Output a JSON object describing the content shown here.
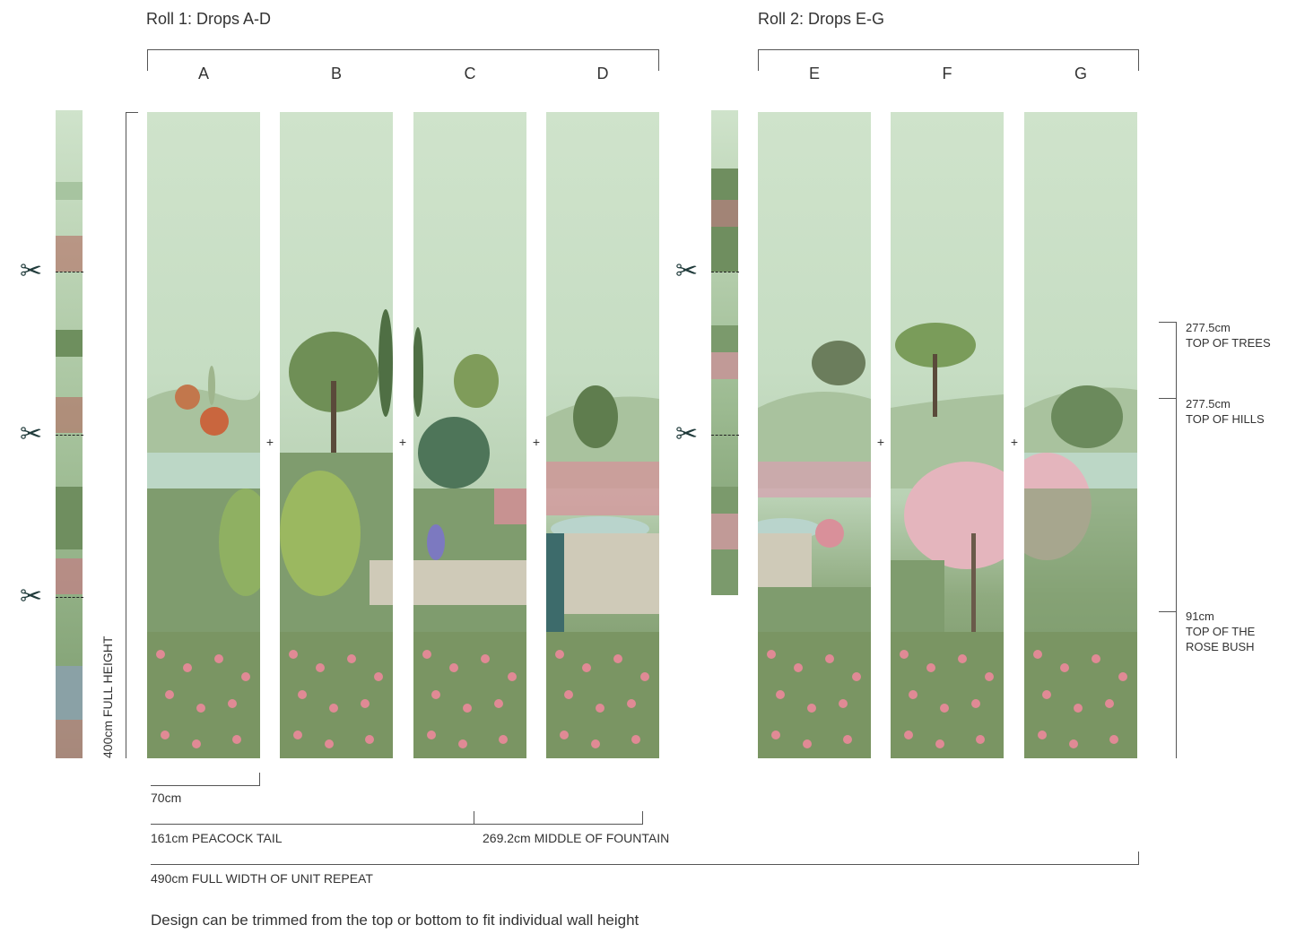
{
  "rolls": [
    {
      "title": "Roll 1: Drops A-D",
      "drops": [
        "A",
        "B",
        "C",
        "D"
      ]
    },
    {
      "title": "Roll 2: Drops E-G",
      "drops": [
        "E",
        "F",
        "G"
      ]
    }
  ],
  "joins": [
    "+",
    "+",
    "+",
    "+",
    "+"
  ],
  "height_label": "400cm FULL HEIGHT",
  "width_labels": {
    "drop_width": "70cm",
    "peacock_tail": "161cm PEACOCK TAIL",
    "fountain": "269.2cm MIDDLE OF FOUNTAIN",
    "full_width": "490cm FULL WIDTH OF UNIT REPEAT"
  },
  "markers": [
    {
      "value": "277.5cm",
      "label": "TOP OF TREES"
    },
    {
      "value": "277.5cm",
      "label": "TOP OF HILLS"
    },
    {
      "value": "91cm",
      "label1": "TOP OF THE",
      "label2": "ROSE BUSH"
    }
  ],
  "note": "Design can be trimmed from the top or bottom to fit individual wall height",
  "icons": {
    "cut": "scissors-icon"
  },
  "colors": {
    "sky": "#cfe3cb",
    "grass": "#7b9a6c",
    "rose": "#e08a95",
    "tree": "#5f7d4e"
  }
}
